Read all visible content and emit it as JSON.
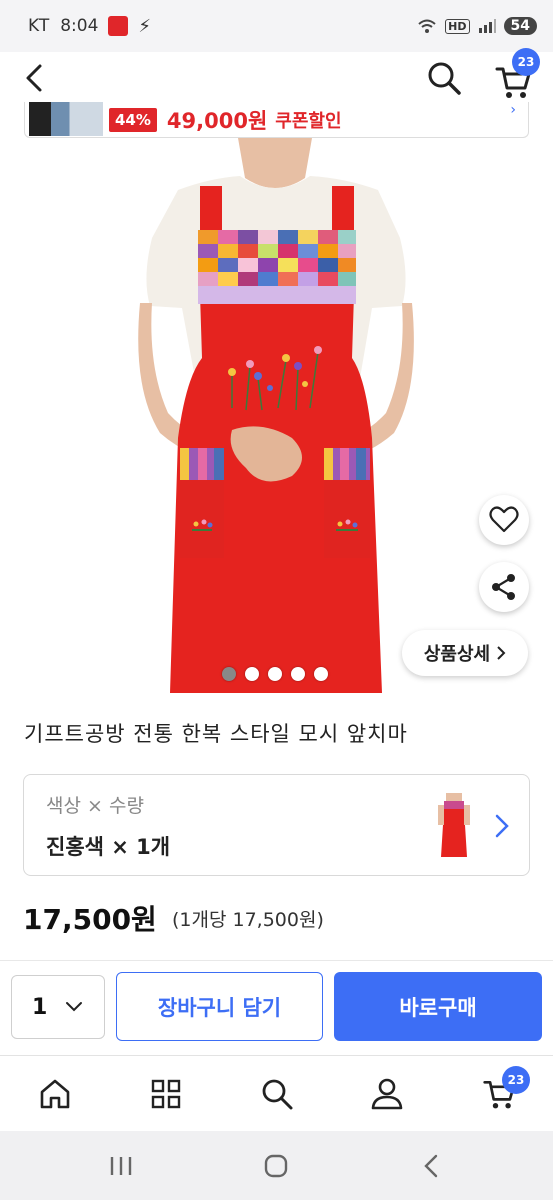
{
  "status_bar": {
    "carrier": "KT",
    "time": "8:04",
    "hd_label": "HD",
    "battery": "54"
  },
  "header": {
    "cart_count": "23"
  },
  "promo": {
    "discount": "44%",
    "price": "49,000원",
    "coupon_label": "쿠폰할인"
  },
  "gallery": {
    "image_count": 5,
    "active_index": 1,
    "detail_label": "상품상세"
  },
  "product": {
    "title": "기프트공방 전통 한복 스타일 모시 앞치마",
    "option_label": "색상 × 수량",
    "option_value": "진홍색 × 1개",
    "price": "17,500원",
    "unit_price": "(1개당 17,500원)"
  },
  "purchase": {
    "quantity": "1",
    "add_to_cart_label": "장바구니 담기",
    "buy_now_label": "바로구매"
  },
  "bottom_nav": {
    "cart_count": "23"
  },
  "colors": {
    "accent": "#3d6ef5",
    "promo_red": "#e0262a",
    "apron_red": "#e5231f"
  },
  "icons": [
    "back-icon",
    "search-icon",
    "cart-icon",
    "heart-icon",
    "share-icon",
    "chevron-right-icon",
    "chevron-down-icon",
    "home-icon",
    "category-grid-icon",
    "user-icon",
    "recent-apps-icon",
    "home-circle-icon",
    "system-back-icon"
  ]
}
